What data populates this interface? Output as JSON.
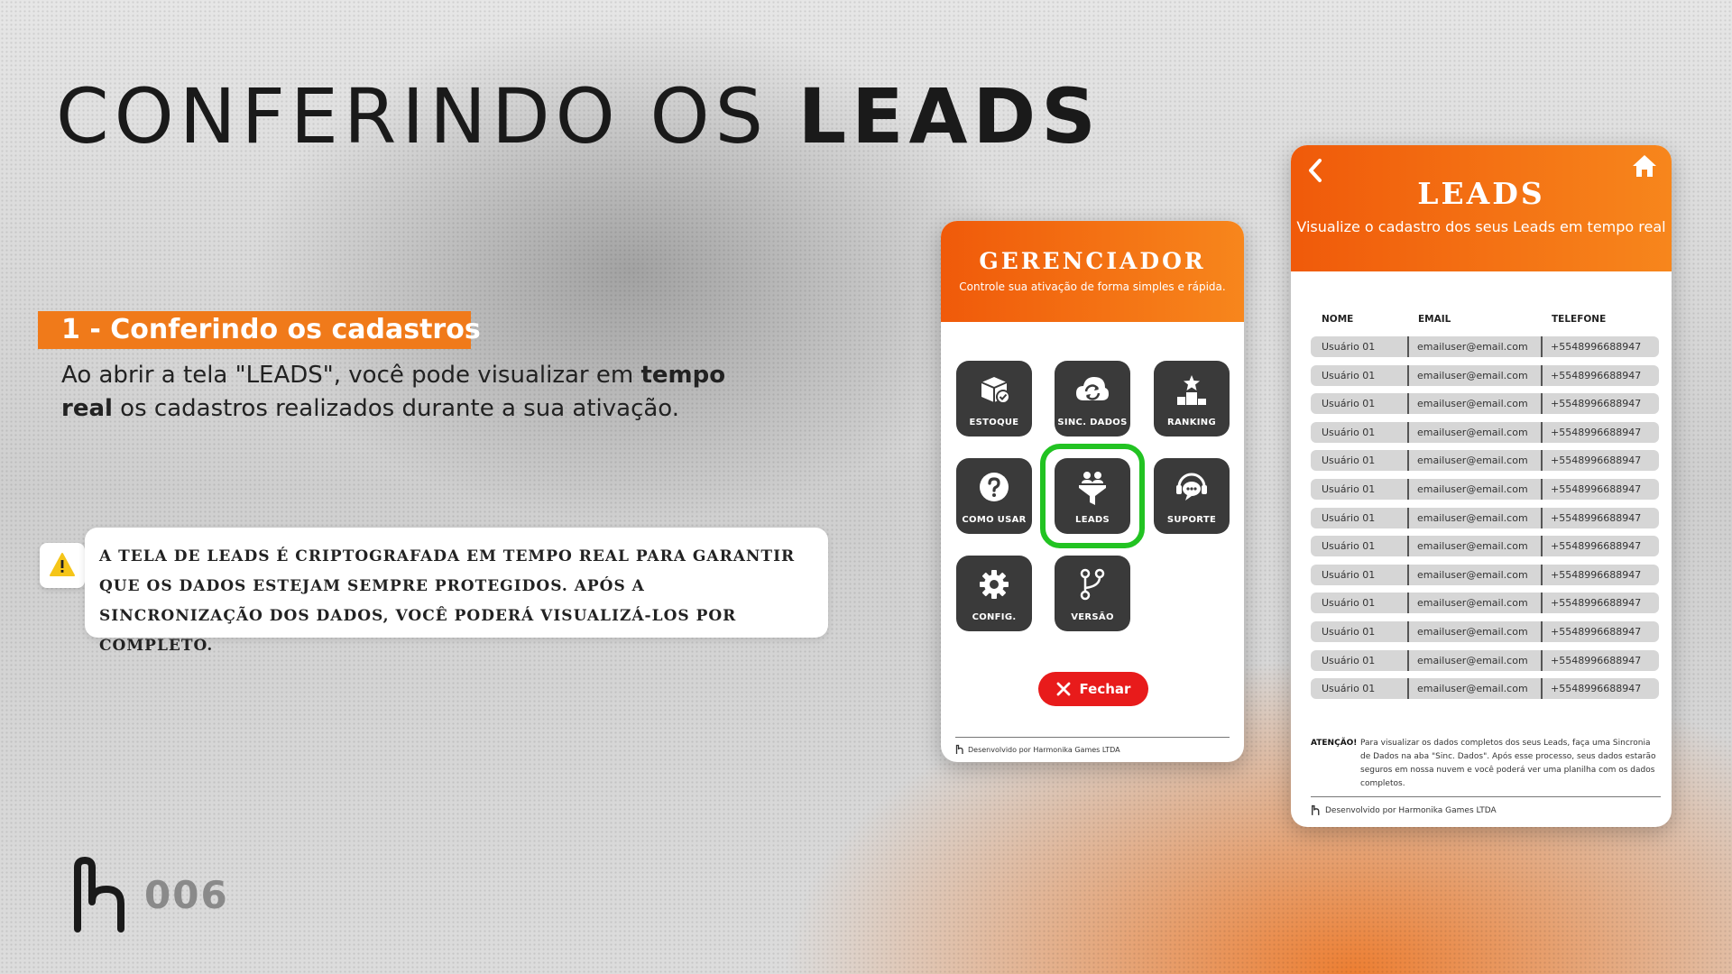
{
  "title": {
    "normal": "CONFERINDO OS ",
    "bold": "LEADS"
  },
  "section": {
    "label": "1 - Conferindo os cadastros",
    "body_part1": "Ao abrir a tela \"LEADS\", você pode visualizar em ",
    "body_bold": "tempo real",
    "body_part2": " os cadastros realizados durante a sua ativação."
  },
  "warning": {
    "text": "A tela de leads é criptografada em tempo real para garantir que os dados estejam sempre protegidos. Após a sincronização dos dados, você poderá visualizá-los por completo."
  },
  "page_number": "006",
  "gerenciador": {
    "title": "GERENCIADOR",
    "subtitle": "Controle sua ativação de forma simples e rápida.",
    "tiles": [
      {
        "label": "ESTOQUE",
        "icon": "box-icon"
      },
      {
        "label": "SINC. DADOS",
        "icon": "cloud-sync-icon"
      },
      {
        "label": "RANKING",
        "icon": "podium-icon"
      },
      {
        "label": "COMO USAR",
        "icon": "question-icon"
      },
      {
        "label": "LEADS",
        "icon": "funnel-users-icon"
      },
      {
        "label": "SUPORTE",
        "icon": "support-chat-icon"
      },
      {
        "label": "CONFIG.",
        "icon": "gear-icon"
      },
      {
        "label": "VERSÃO",
        "icon": "branch-icon"
      }
    ],
    "close_label": "Fechar",
    "footer": "Desenvolvido por Harmonika Games LTDA",
    "highlight_color": "#22c322"
  },
  "leads": {
    "title": "LEADS",
    "subtitle": "Visualize o cadastro dos seus Leads em tempo real",
    "columns": [
      "NOME",
      "EMAIL",
      "TELEFONE"
    ],
    "rows": [
      [
        "Usuário 01",
        "emailuser@email.com",
        "+5548996688947"
      ],
      [
        "Usuário 01",
        "emailuser@email.com",
        "+5548996688947"
      ],
      [
        "Usuário 01",
        "emailuser@email.com",
        "+5548996688947"
      ],
      [
        "Usuário 01",
        "emailuser@email.com",
        "+5548996688947"
      ],
      [
        "Usuário 01",
        "emailuser@email.com",
        "+5548996688947"
      ],
      [
        "Usuário 01",
        "emailuser@email.com",
        "+5548996688947"
      ],
      [
        "Usuário 01",
        "emailuser@email.com",
        "+5548996688947"
      ],
      [
        "Usuário 01",
        "emailuser@email.com",
        "+5548996688947"
      ],
      [
        "Usuário 01",
        "emailuser@email.com",
        "+5548996688947"
      ],
      [
        "Usuário 01",
        "emailuser@email.com",
        "+5548996688947"
      ],
      [
        "Usuário 01",
        "emailuser@email.com",
        "+5548996688947"
      ],
      [
        "Usuário 01",
        "emailuser@email.com",
        "+5548996688947"
      ],
      [
        "Usuário 01",
        "emailuser@email.com",
        "+5548996688947"
      ]
    ],
    "note_label": "ATENÇÃO!",
    "note_text": "Para visualizar os dados completos dos seus Leads, faça uma Sincronia de Dados na aba \"Sinc. Dados\". Após esse processo, seus dados estarão seguros em nossa nuvem e você poderá ver uma planilha com os dados completos.",
    "footer": "Desenvolvido por Harmonika Games LTDA"
  },
  "colors": {
    "accent": "#f07a1a",
    "tile": "#3a3a3a",
    "close": "#e81b1b"
  }
}
